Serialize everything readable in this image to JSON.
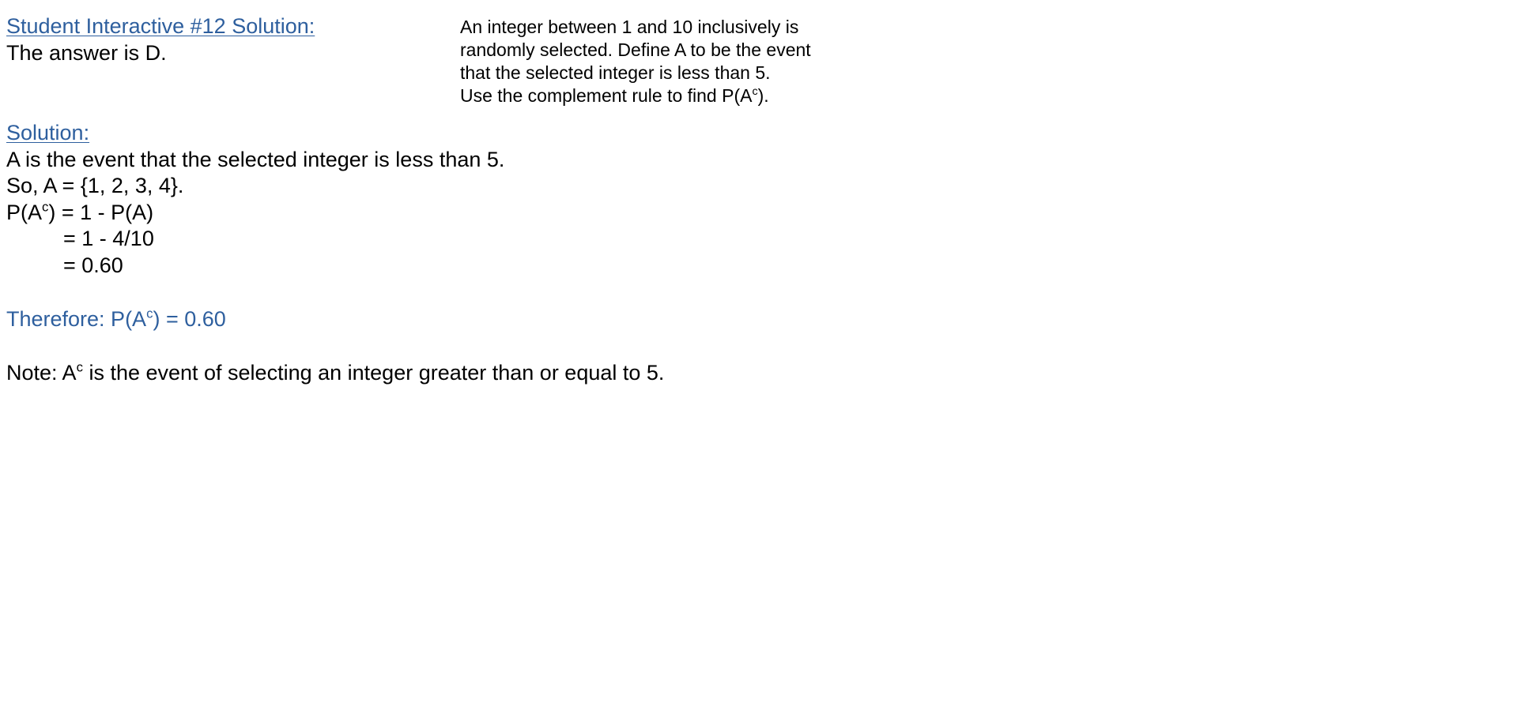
{
  "header": {
    "title": "Student Interactive #12 Solution:",
    "answer": "The answer is D."
  },
  "problem": {
    "line1": "An integer between 1 and 10 inclusively is",
    "line2": "randomly selected.  Define A to be the event",
    "line3": "that the selected integer is less than 5.",
    "line4_prefix": "Use the complement rule to find P(A",
    "line4_sup": "c",
    "line4_suffix": ")."
  },
  "solution": {
    "heading": "Solution:",
    "line1": "A is the event that the selected integer is less than 5.",
    "line2": "So, A = {1, 2, 3, 4}.",
    "line3_prefix": "P(A",
    "line3_sup": "c",
    "line3_suffix": ") = 1 - P(A)",
    "line4": "= 1 - 4/10",
    "line5": "= 0.60"
  },
  "therefore": {
    "prefix": "Therefore:  P(A",
    "sup": "c",
    "suffix": ") = 0.60"
  },
  "note": {
    "prefix": "Note:  A",
    "sup": "c",
    "suffix": " is the event of selecting an integer greater than or equal to 5."
  },
  "colors": {
    "heading_blue": "#2e5f9e",
    "text": "#000000",
    "background": "#ffffff"
  }
}
